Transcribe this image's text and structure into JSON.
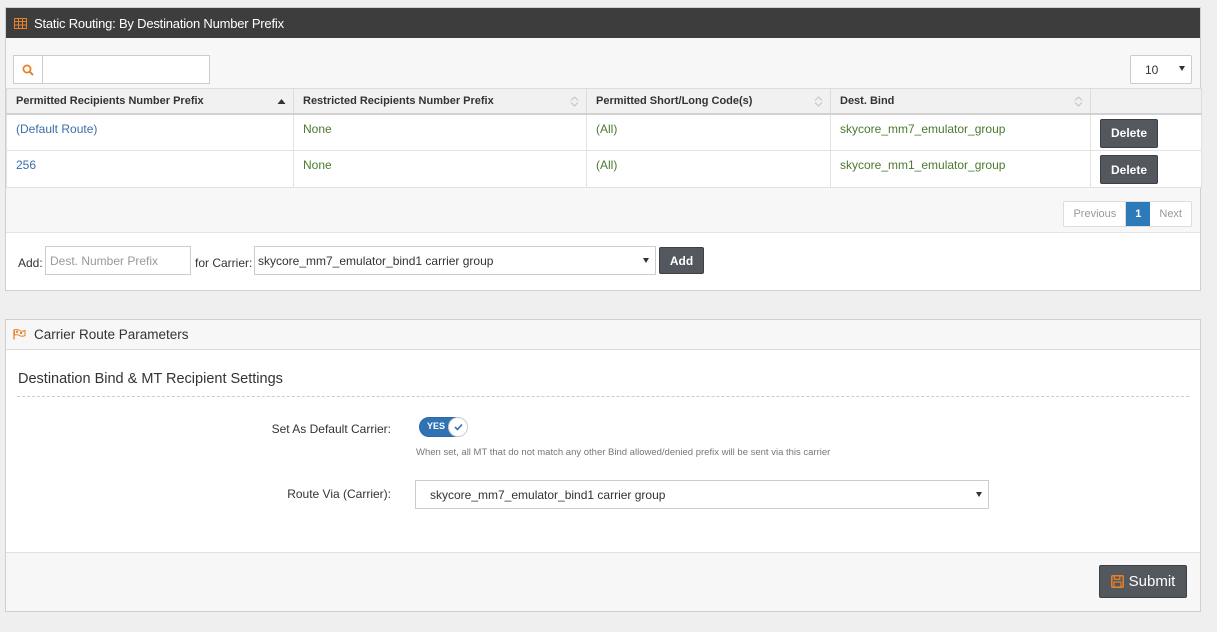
{
  "panel1": {
    "title": "Static Routing: By Destination Number Prefix",
    "search": {
      "value": "",
      "placeholder": ""
    },
    "page_size": "10",
    "columns": [
      "Permitted Recipients Number Prefix",
      "Restricted Recipients Number Prefix",
      "Permitted Short/Long Code(s)",
      "Dest. Bind",
      ""
    ],
    "rows": [
      {
        "prefix": "(Default Route)",
        "restricted": "None",
        "codes": "(All)",
        "bind": "skycore_mm7_emulator_group",
        "action": "Delete"
      },
      {
        "prefix": "256",
        "restricted": "None",
        "codes": "(All)",
        "bind": "skycore_mm1_emulator_group",
        "action": "Delete"
      }
    ],
    "pager": {
      "previous": "Previous",
      "current": "1",
      "next": "Next"
    },
    "add": {
      "label": "Add:",
      "prefix_placeholder": "Dest. Number Prefix",
      "carrier_label": "for Carrier:",
      "carrier_value": "skycore_mm7_emulator_bind1 carrier group",
      "button": "Add"
    }
  },
  "panel2": {
    "title": "Carrier Route Parameters",
    "section_title": "Destination Bind & MT Recipient Settings",
    "default_carrier": {
      "label": "Set As Default Carrier:",
      "toggle_text": "YES",
      "help": "When set, all MT that do not match any other Bind allowed/denied prefix will be sent via this carrier"
    },
    "route_via": {
      "label": "Route Via (Carrier):",
      "value": "skycore_mm7_emulator_bind1 carrier group"
    },
    "submit": "Submit"
  },
  "colors": {
    "header_dark": "#3d3d3d",
    "accent_orange": "#e8822a",
    "button_dark": "#53575e",
    "link_blue": "#3a6fa8",
    "value_green": "#4b7a2f",
    "toggle_blue": "#2f73b3"
  },
  "icons": {
    "panel1_header": "table-icon",
    "search": "search-icon",
    "panel2_header": "flag-icon",
    "submit": "floppy-disk-icon"
  }
}
